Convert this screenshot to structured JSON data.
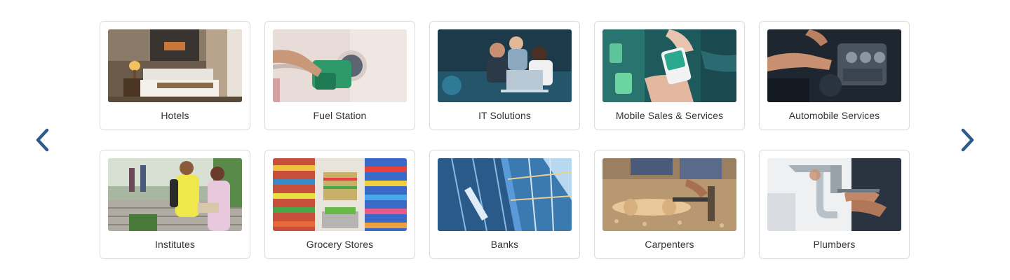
{
  "carousel": {
    "prev_icon": "chevron-left-icon",
    "next_icon": "chevron-right-icon",
    "arrow_color": "#2e5b8c"
  },
  "categories": [
    {
      "label": "Hotels"
    },
    {
      "label": "Fuel Station"
    },
    {
      "label": "IT Solutions"
    },
    {
      "label": "Mobile Sales & Services"
    },
    {
      "label": "Automobile Services"
    },
    {
      "label": "Institutes"
    },
    {
      "label": "Grocery Stores"
    },
    {
      "label": "Banks"
    },
    {
      "label": "Carpenters"
    },
    {
      "label": "Plumbers"
    }
  ]
}
